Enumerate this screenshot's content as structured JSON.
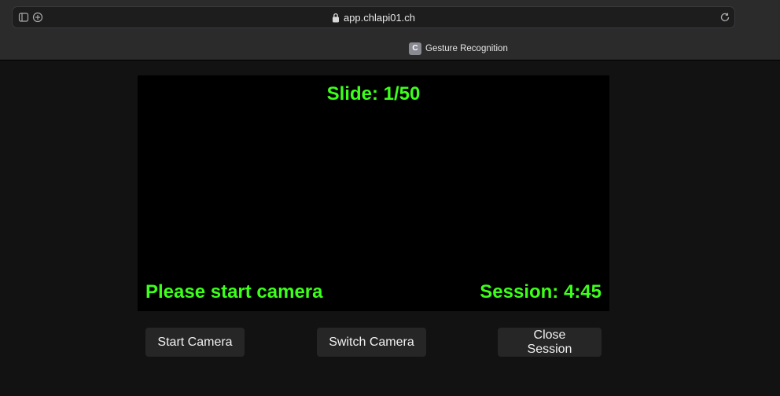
{
  "browser": {
    "url": "app.chlapi01.ch",
    "tab": {
      "favicon_letter": "C",
      "title": "Gesture Recognition"
    }
  },
  "video": {
    "slide_counter": "Slide: 1/50",
    "status": "Please start camera",
    "session_timer": "Session: 4:45",
    "overlay_color": "#3cff1a"
  },
  "controls": {
    "start_camera": "Start Camera",
    "switch_camera": "Switch Camera",
    "close_session": "Close Session"
  }
}
